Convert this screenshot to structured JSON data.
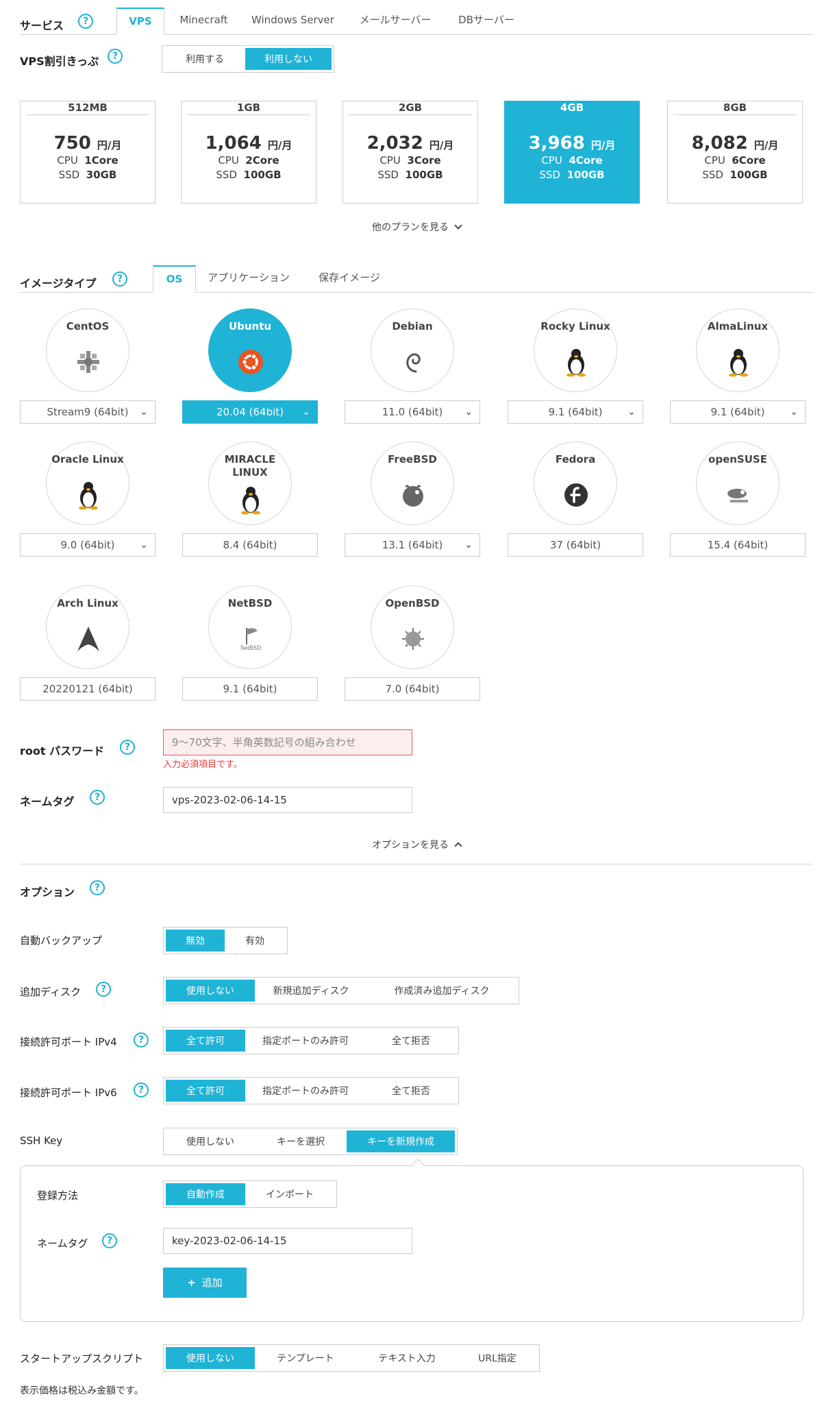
{
  "service": {
    "label": "サービス",
    "tabs": [
      "VPS",
      "Minecraft",
      "Windows Server",
      "メールサーバー",
      "DBサーバー"
    ]
  },
  "discount": {
    "label": "VPS割引きっぷ",
    "options": [
      "利用する",
      "利用しない"
    ]
  },
  "plans": [
    {
      "name": "512MB",
      "price": "750",
      "unit": "円/月",
      "cpu_label": "CPU",
      "cpu": "1Core",
      "ssd_label": "SSD",
      "ssd": "30GB"
    },
    {
      "name": "1GB",
      "price": "1,064",
      "unit": "円/月",
      "cpu_label": "CPU",
      "cpu": "2Core",
      "ssd_label": "SSD",
      "ssd": "100GB"
    },
    {
      "name": "2GB",
      "price": "2,032",
      "unit": "円/月",
      "cpu_label": "CPU",
      "cpu": "3Core",
      "ssd_label": "SSD",
      "ssd": "100GB"
    },
    {
      "name": "4GB",
      "price": "3,968",
      "unit": "円/月",
      "cpu_label": "CPU",
      "cpu": "4Core",
      "ssd_label": "SSD",
      "ssd": "100GB"
    },
    {
      "name": "8GB",
      "price": "8,082",
      "unit": "円/月",
      "cpu_label": "CPU",
      "cpu": "6Core",
      "ssd_label": "SSD",
      "ssd": "100GB"
    }
  ],
  "more_plans": "他のプランを見る",
  "image_type": {
    "label": "イメージタイプ",
    "tabs": [
      "OS",
      "アプリケーション",
      "保存イメージ"
    ]
  },
  "os_list": [
    {
      "name": "CentOS",
      "version": "Stream9 (64bit)",
      "icon": "centos-icon"
    },
    {
      "name": "Ubuntu",
      "version": "20.04 (64bit)",
      "icon": "ubuntu-icon"
    },
    {
      "name": "Debian",
      "version": "11.0 (64bit)",
      "icon": "debian-icon"
    },
    {
      "name": "Rocky Linux",
      "version": "9.1 (64bit)",
      "icon": "tux-icon"
    },
    {
      "name": "AlmaLinux",
      "version": "9.1 (64bit)",
      "icon": "tux-icon"
    },
    {
      "name": "Oracle Linux",
      "version": "9.0 (64bit)",
      "icon": "tux-icon"
    },
    {
      "name": "MIRACLE LINUX",
      "version": "8.4 (64bit)",
      "icon": "tux-icon"
    },
    {
      "name": "FreeBSD",
      "version": "13.1 (64bit)",
      "icon": "freebsd-icon"
    },
    {
      "name": "Fedora",
      "version": "37 (64bit)",
      "icon": "fedora-icon"
    },
    {
      "name": "openSUSE",
      "version": "15.4 (64bit)",
      "icon": "opensuse-icon"
    },
    {
      "name": "Arch Linux",
      "version": "20220121 (64bit)",
      "icon": "arch-icon"
    },
    {
      "name": "NetBSD",
      "version": "9.1 (64bit)",
      "icon": "netbsd-icon"
    },
    {
      "name": "OpenBSD",
      "version": "7.0 (64bit)",
      "icon": "openbsd-icon"
    }
  ],
  "root_password": {
    "label": "root パスワード",
    "placeholder": "9～70文字、半角英数記号の組み合わせ",
    "error": "入力必須項目です。"
  },
  "name_tag": {
    "label": "ネームタグ",
    "value": "vps-2023-02-06-14-15"
  },
  "options_toggle": "オプションを見る",
  "options": {
    "label": "オプション",
    "auto_backup": {
      "label": "自動バックアップ",
      "options": [
        "無効",
        "有効"
      ]
    },
    "extra_disk": {
      "label": "追加ディスク",
      "options": [
        "使用しない",
        "新規追加ディスク",
        "作成済み追加ディスク"
      ]
    },
    "port_ipv4": {
      "label": "接続許可ポート IPv4",
      "options": [
        "全て許可",
        "指定ポートのみ許可",
        "全て拒否"
      ]
    },
    "port_ipv6": {
      "label": "接続許可ポート IPv6",
      "options": [
        "全て許可",
        "指定ポートのみ許可",
        "全て拒否"
      ]
    },
    "ssh_key": {
      "label": "SSH Key",
      "options": [
        "使用しない",
        "キーを選択",
        "キーを新規作成"
      ]
    },
    "register_method": {
      "label": "登録方法",
      "options": [
        "自動作成",
        "インポート"
      ]
    },
    "key_name_tag": {
      "label": "ネームタグ",
      "value": "key-2023-02-06-14-15"
    },
    "add_button": "追加",
    "startup_script": {
      "label": "スタートアップスクリプト",
      "options": [
        "使用しない",
        "テンプレート",
        "テキスト入力",
        "URL指定"
      ]
    }
  },
  "footer_note": "表示価格は税込み金額です。",
  "colors": {
    "accent": "#1fb3d6",
    "error": "#e53935"
  }
}
